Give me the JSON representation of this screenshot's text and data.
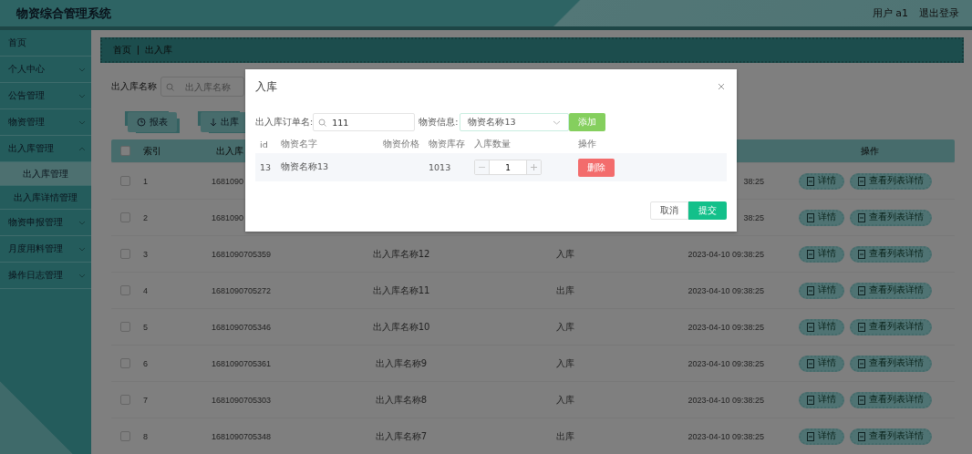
{
  "header": {
    "title": "物资综合管理系统",
    "user": "用户 a1",
    "logout": "退出登录"
  },
  "sidebar": {
    "items": [
      {
        "label": "首页",
        "has_arrow": false
      },
      {
        "label": "个人中心",
        "expanded": false,
        "has_arrow": true
      },
      {
        "label": "公告管理",
        "expanded": false,
        "has_arrow": true
      },
      {
        "label": "物资管理",
        "expanded": false,
        "has_arrow": true
      },
      {
        "label": "出入库管理",
        "expanded": true,
        "has_arrow": true,
        "children": [
          {
            "label": "出入库管理",
            "selected": true
          },
          {
            "label": "出入库详情管理",
            "selected": false
          }
        ]
      },
      {
        "label": "物资申报管理",
        "expanded": false,
        "has_arrow": true
      },
      {
        "label": "月度用料管理",
        "expanded": false,
        "has_arrow": true
      },
      {
        "label": "操作日志管理",
        "expanded": false,
        "has_arrow": true
      }
    ]
  },
  "breadcrumb": [
    "首页",
    "出入库"
  ],
  "search": {
    "label": "出入库名称",
    "placeholder": "出入库名称"
  },
  "toolbar": [
    {
      "kind": "report",
      "label": "报表"
    },
    {
      "kind": "out",
      "label": "出库"
    }
  ],
  "table": {
    "select_all": {
      "checked": false
    },
    "columns": [
      "索引",
      "出入库",
      "操作"
    ],
    "rows": [
      {
        "checked": false,
        "index": "1",
        "column_2": "1681090",
        "column_5": "38:25",
        "actions": [
          "详情",
          "查看列表详情"
        ]
      },
      {
        "checked": false,
        "index": "2",
        "column_2": "1681090",
        "column_5": "38:25",
        "actions": [
          "详情",
          "查看列表详情"
        ]
      },
      {
        "checked": false,
        "index": "3",
        "column_2": "1681090705359",
        "column_3": "出入库名称12",
        "column_4": "入库",
        "column_5": "2023-04-10 09:38:25",
        "actions": [
          "详情",
          "查看列表详情"
        ]
      },
      {
        "checked": false,
        "index": "4",
        "column_2": "1681090705272",
        "column_3": "出入库名称11",
        "column_4": "出库",
        "column_5": "2023-04-10 09:38:25",
        "actions": [
          "详情",
          "查看列表详情"
        ]
      },
      {
        "checked": false,
        "index": "5",
        "column_2": "1681090705346",
        "column_3": "出入库名称10",
        "column_4": "入库",
        "column_5": "2023-04-10 09:38:25",
        "actions": [
          "详情",
          "查看列表详情"
        ]
      },
      {
        "checked": false,
        "index": "6",
        "column_2": "1681090705361",
        "column_3": "出入库名称9",
        "column_4": "入库",
        "column_5": "2023-04-10 09:38:25",
        "actions": [
          "详情",
          "查看列表详情"
        ]
      },
      {
        "checked": false,
        "index": "7",
        "column_2": "1681090705303",
        "column_3": "出入库名称8",
        "column_4": "入库",
        "column_5": "2023-04-10 09:38:25",
        "actions": [
          "详情",
          "查看列表详情"
        ]
      },
      {
        "checked": false,
        "index": "8",
        "column_2": "1681090705348",
        "column_3": "出入库名称7",
        "column_4": "出库",
        "column_5": "2023-04-10 09:38:25",
        "actions": [
          "详情",
          "查看列表详情"
        ]
      }
    ]
  },
  "dialog": {
    "title": "入库",
    "order_label": "出入库订单名:",
    "order_value": "111",
    "material_label": "物资信息:",
    "material_value": "物资名称13",
    "add_button": "添加",
    "columns": [
      "id",
      "物资名字",
      "物资价格",
      "物资库存",
      "入库数量",
      "操作"
    ],
    "rows": [
      {
        "id": "13",
        "name": "物资名称13",
        "stock": "1013",
        "quantity": "1",
        "delete": "删除"
      }
    ],
    "cancel": "取消",
    "submit": "提交"
  }
}
